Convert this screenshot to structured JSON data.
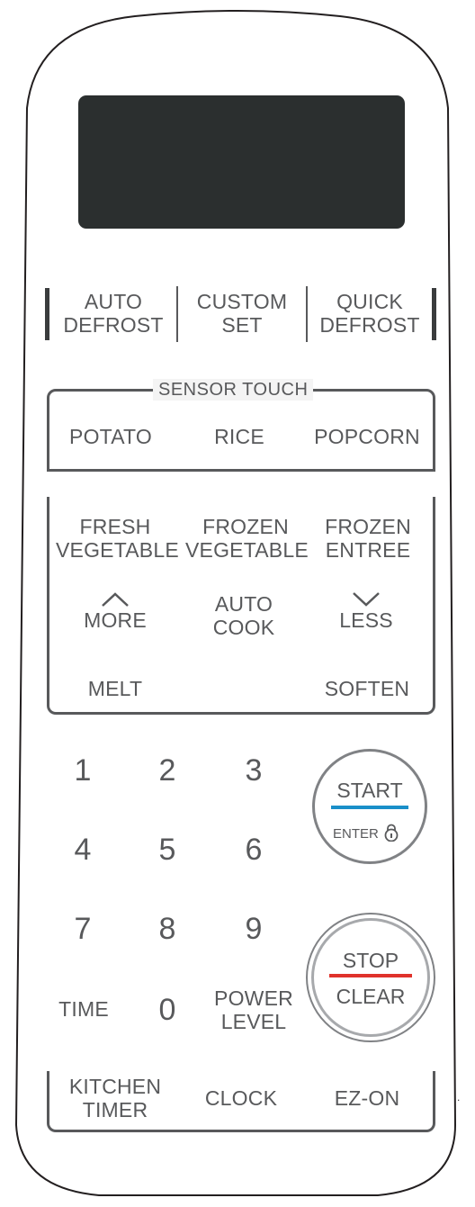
{
  "program_keys": {
    "auto_defrost": [
      "AUTO",
      "DEFROST"
    ],
    "custom_set": [
      "CUSTOM",
      "SET"
    ],
    "quick_defrost": [
      "QUICK",
      "DEFROST"
    ]
  },
  "sensor_touch": {
    "title": "SENSOR TOUCH",
    "keys": [
      "POTATO",
      "RICE",
      "POPCORN"
    ]
  },
  "auto_cook": {
    "fresh_vegetable": [
      "FRESH",
      "VEGETABLE"
    ],
    "frozen_vegetable": [
      "FROZEN",
      "VEGETABLE"
    ],
    "frozen_entree": [
      "FROZEN",
      "ENTREE"
    ],
    "more": "MORE",
    "auto_cook": [
      "AUTO",
      "COOK"
    ],
    "less": "LESS",
    "melt": "MELT",
    "soften": "SOFTEN"
  },
  "numpad": {
    "digits": [
      "1",
      "2",
      "3",
      "4",
      "5",
      "6",
      "7",
      "8",
      "9",
      "0"
    ],
    "time": "TIME",
    "power_level": [
      "POWER",
      "LEVEL"
    ]
  },
  "start": {
    "label": "START",
    "sub": "ENTER",
    "accent": "#1a8fc9"
  },
  "stop": {
    "label": "STOP",
    "sub": "CLEAR",
    "accent": "#e0322b"
  },
  "bottom_keys": {
    "kitchen_timer": [
      "KITCHEN",
      "TIMER"
    ],
    "clock": "CLOCK",
    "ez_on": "EZ-ON"
  },
  "icons": [
    "chevron-up-icon",
    "chevron-down-icon",
    "lock-icon"
  ],
  "colors": {
    "display": "#2b2f2f",
    "text": "#58595b",
    "outline": "#231f20"
  }
}
